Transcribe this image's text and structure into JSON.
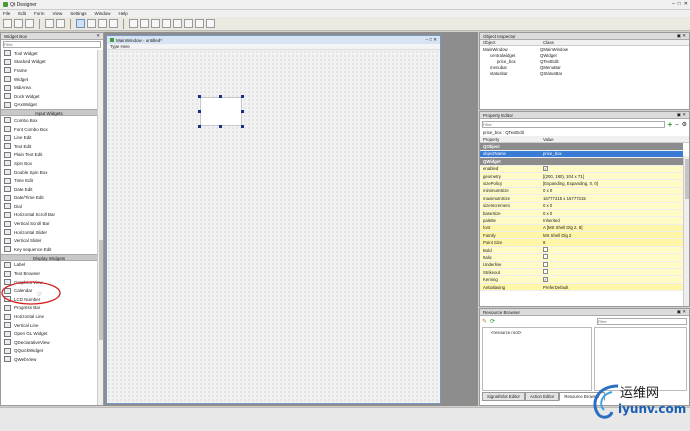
{
  "app": {
    "title": "Qt Designer"
  },
  "menu": [
    "File",
    "Edit",
    "Form",
    "View",
    "Settings",
    "Window",
    "Help"
  ],
  "widget_box": {
    "title": "Widget Box",
    "filter_placeholder": "Filter",
    "items_top": [
      "Tool Widget",
      "Stacked Widget",
      "Frame",
      "Widget",
      "MdiArea",
      "Dock Widget",
      "QAxWidget"
    ],
    "cat_input": "Input Widgets",
    "items_input": [
      "Combo Box",
      "Font Combo Box",
      "Line Edit",
      "Text Edit",
      "Plain Text Edit",
      "Spin Box",
      "Double Spin Box",
      "Time Edit",
      "Date Edit",
      "Date/Time Edit",
      "Dial",
      "Horizontal Scroll Bar",
      "Vertical Scroll Bar",
      "Horizontal Slider",
      "Vertical Slider",
      "Key sequence Edit"
    ],
    "cat_display": "Display Widgets",
    "items_display": [
      "Label",
      "Text Browser",
      "Graphics View",
      "Calendar",
      "LCD Number",
      "Progress Bar",
      "Horizontal Line",
      "Vertical Line",
      "Open GL Widget",
      "QDeclarativeView",
      "QQuickWidget",
      "QWebView"
    ]
  },
  "form": {
    "title": "MainWindow - untitled*",
    "type_here": "Type Here"
  },
  "object_inspector": {
    "title": "Object Inspector",
    "headers": [
      "Object",
      "Class"
    ],
    "rows": [
      {
        "object": "MainWindow",
        "class": "QMainWindow"
      },
      {
        "object": "centralwidget",
        "class": "QWidget"
      },
      {
        "object": "price_box",
        "class": "QTextEdit"
      },
      {
        "object": "menubar",
        "class": "QMenuBar"
      },
      {
        "object": "statusbar",
        "class": "QStatusBar"
      }
    ]
  },
  "property_editor": {
    "title": "Property Editor",
    "filter_placeholder": "Filter",
    "context": "price_box : QTextEdit",
    "headers": [
      "Property",
      "Value"
    ],
    "rows": [
      {
        "p": "QObject",
        "v": "",
        "kind": "sect"
      },
      {
        "p": "objectName",
        "v": "price_box",
        "kind": "sel"
      },
      {
        "p": "QWidget",
        "v": "",
        "kind": "sect"
      },
      {
        "p": "enabled",
        "v": "✓",
        "kind": "chk"
      },
      {
        "p": "geometry",
        "v": "[(200, 180), 104 x 71]",
        "kind": "y"
      },
      {
        "p": "sizePolicy",
        "v": "[Expanding, Expanding, 0, 0]",
        "kind": "y"
      },
      {
        "p": "minimumSize",
        "v": "0 x 0",
        "kind": "y"
      },
      {
        "p": "maximumSize",
        "v": "16777215 x 16777215",
        "kind": "y"
      },
      {
        "p": "sizeIncrement",
        "v": "0 x 0",
        "kind": "y"
      },
      {
        "p": "baseSize",
        "v": "0 x 0",
        "kind": "y"
      },
      {
        "p": "palette",
        "v": "Inherited",
        "kind": "y"
      },
      {
        "p": "font",
        "v": "A  [MS Shell Dlg 2, 8]",
        "kind": "y2"
      },
      {
        "p": "Family",
        "v": "MS Shell Dlg 2",
        "kind": "y2"
      },
      {
        "p": "Point Size",
        "v": "8",
        "kind": "y2"
      },
      {
        "p": "Bold",
        "v": "",
        "kind": "chk"
      },
      {
        "p": "Italic",
        "v": "",
        "kind": "chk"
      },
      {
        "p": "Underline",
        "v": "",
        "kind": "chk"
      },
      {
        "p": "Strikeout",
        "v": "",
        "kind": "chk"
      },
      {
        "p": "Kerning",
        "v": "✓",
        "kind": "chk"
      },
      {
        "p": "Antialiasing",
        "v": "PreferDefault",
        "kind": "y2"
      }
    ]
  },
  "resource_browser": {
    "title": "Resource Browser",
    "filter_placeholder": "Filter",
    "root": "<resource root>",
    "tabs": [
      "Signal/Slot Editor",
      "Action Editor",
      "Resource Browser"
    ]
  },
  "watermark": {
    "cn": "运维网",
    "url": "iyunv.com"
  },
  "colors": {
    "selection": "#3a7bd5",
    "property_yellow": "#fffbc6",
    "annotation_red": "#d42020"
  }
}
